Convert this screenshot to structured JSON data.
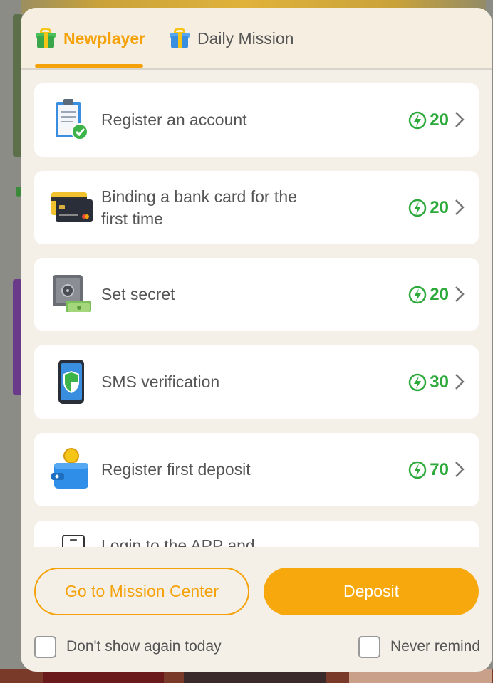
{
  "tabs": [
    {
      "label": "Newplayer",
      "icon": "gift-icon",
      "active": true
    },
    {
      "label": "Daily Mission",
      "icon": "gift-icon",
      "active": false
    }
  ],
  "missions": [
    {
      "label": "Register an account",
      "icon": "clipboard-check-icon",
      "reward": "20"
    },
    {
      "label": "Binding a bank card for the first time",
      "icon": "bank-card-icon",
      "reward": "20"
    },
    {
      "label": "Set secret",
      "icon": "safe-icon",
      "reward": "20"
    },
    {
      "label": "SMS verification",
      "icon": "phone-shield-icon",
      "reward": "30"
    },
    {
      "label": "Register first deposit",
      "icon": "wallet-coin-icon",
      "reward": "70"
    },
    {
      "label": "Login to the APP and",
      "icon": "app-phone-icon",
      "reward": ""
    }
  ],
  "buttons": {
    "mission_center": "Go to Mission Center",
    "deposit": "Deposit"
  },
  "checks": {
    "dont_show": "Don't show again today",
    "never_remind": "Never remind"
  },
  "colors": {
    "accent": "#f5a20a",
    "reward_green": "#2eaa3c",
    "modal_bg": "#f4f0e8"
  }
}
